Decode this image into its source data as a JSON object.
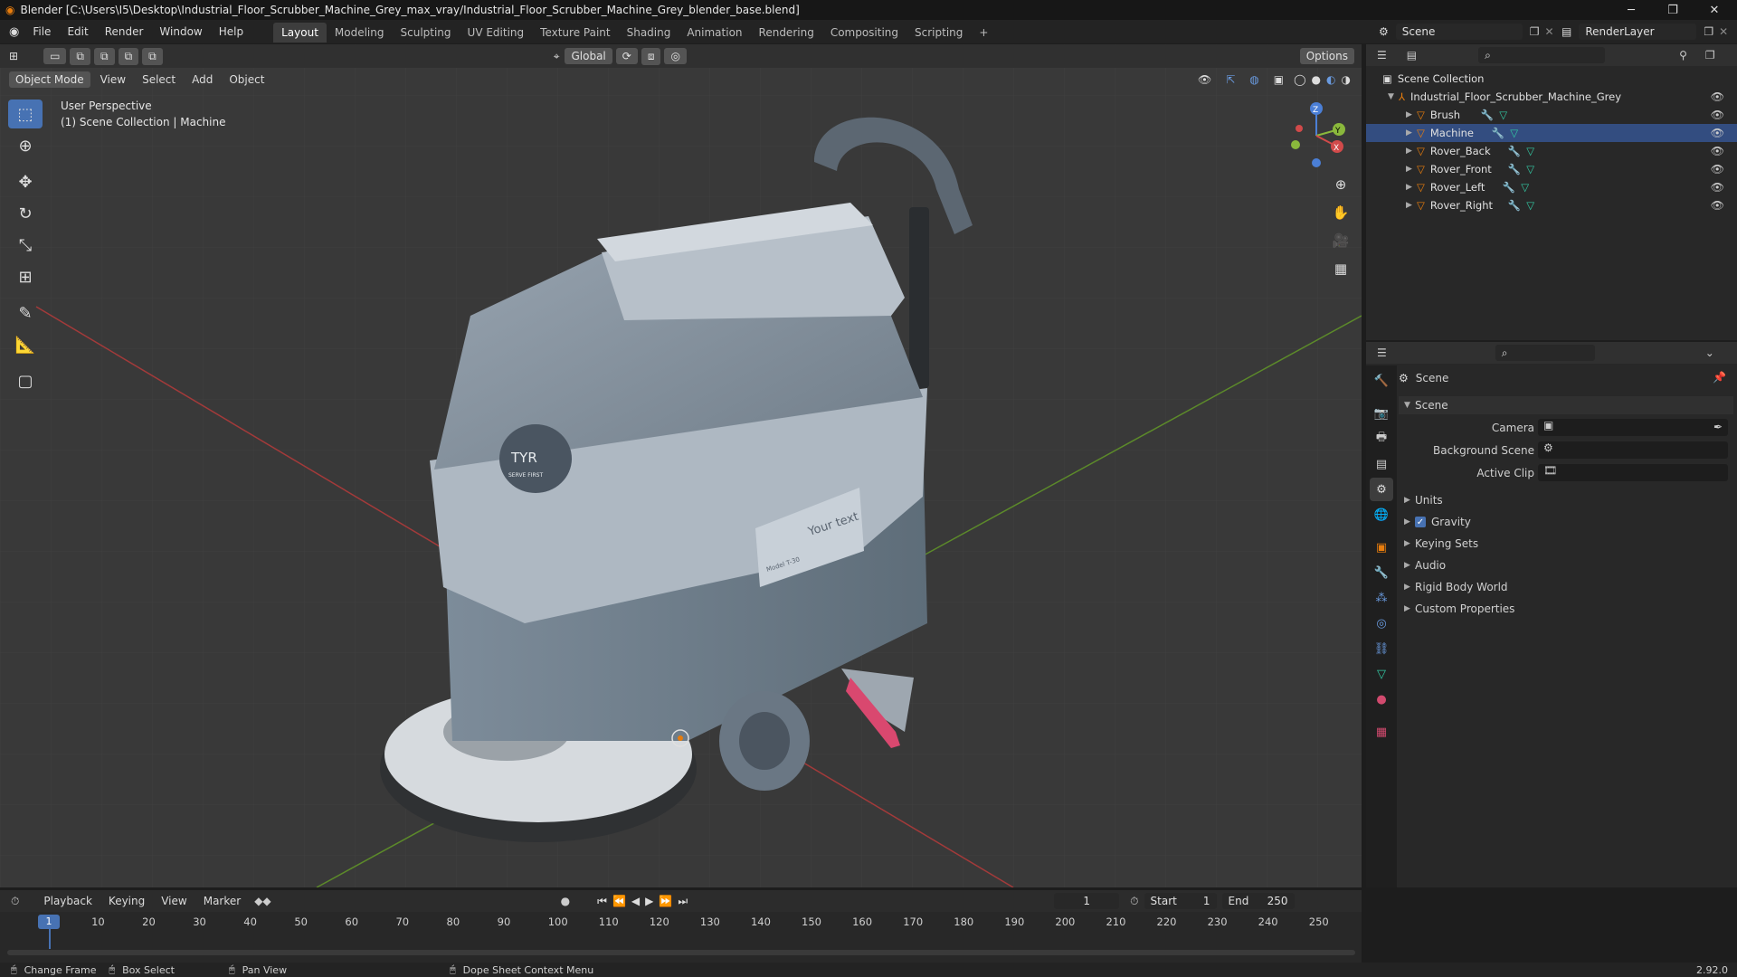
{
  "window": {
    "title": "Blender [C:\\Users\\I5\\Desktop\\Industrial_Floor_Scrubber_Machine_Grey_max_vray/Industrial_Floor_Scrubber_Machine_Grey_blender_base.blend]",
    "minimize": "─",
    "maximize": "❐",
    "close": "✕"
  },
  "menu": [
    "File",
    "Edit",
    "Render",
    "Window",
    "Help"
  ],
  "workspaces": [
    {
      "label": "Layout",
      "active": true
    },
    {
      "label": "Modeling"
    },
    {
      "label": "Sculpting"
    },
    {
      "label": "UV Editing"
    },
    {
      "label": "Texture Paint"
    },
    {
      "label": "Shading"
    },
    {
      "label": "Animation"
    },
    {
      "label": "Rendering"
    },
    {
      "label": "Compositing"
    },
    {
      "label": "Scripting"
    }
  ],
  "add_workspace": "+",
  "scene_selector": {
    "value": "Scene"
  },
  "renderlayer_selector": {
    "value": "RenderLayer"
  },
  "viewport_header": {
    "mode": "Object Mode",
    "menus": [
      "View",
      "Select",
      "Add",
      "Object"
    ],
    "transform_orientation": "Global",
    "options": "Options"
  },
  "viewport_overlay_text": {
    "line1": "User Perspective",
    "line2": "(1) Scene Collection | Machine"
  },
  "gizmo": {
    "z": "Z",
    "y": "Y",
    "x": "X"
  },
  "model_labels": {
    "logo": "TYR",
    "logo_sub": "SERVE FIRST",
    "panel_text": "Your text",
    "model_text": "Model  T-30"
  },
  "outliner": {
    "root": "Scene Collection",
    "collection": "Industrial_Floor_Scrubber_Machine_Grey",
    "objects": [
      "Brush",
      "Machine",
      "Rover_Back",
      "Rover_Front",
      "Rover_Left",
      "Rover_Right"
    ]
  },
  "properties": {
    "header": "Scene",
    "panel": "Scene",
    "fields": [
      {
        "label": "Camera",
        "value": ""
      },
      {
        "label": "Background Scene",
        "value": ""
      },
      {
        "label": "Active Clip",
        "value": ""
      }
    ],
    "subpanels": [
      {
        "label": "Units"
      },
      {
        "label": "Gravity",
        "checked": true
      },
      {
        "label": "Keying Sets"
      },
      {
        "label": "Audio"
      },
      {
        "label": "Rigid Body World"
      },
      {
        "label": "Custom Properties"
      }
    ]
  },
  "timeline": {
    "menus": [
      "Playback",
      "Keying",
      "View",
      "Marker"
    ],
    "current_frame": "1",
    "start_label": "Start",
    "start": "1",
    "end_label": "End",
    "end": "250",
    "ticks": [
      "10",
      "20",
      "30",
      "40",
      "50",
      "60",
      "70",
      "80",
      "90",
      "100",
      "110",
      "120",
      "130",
      "140",
      "150",
      "160",
      "170",
      "180",
      "190",
      "200",
      "210",
      "220",
      "230",
      "240",
      "250"
    ],
    "playhead": "1"
  },
  "statusbar": {
    "items": [
      "Change Frame",
      "Box Select",
      "Pan View",
      "Dope Sheet Context Menu"
    ],
    "version": "2.92.0"
  },
  "colors": {
    "accent": "#4772b3",
    "object": "#e87d0d",
    "mesh": "#33c9a3"
  }
}
